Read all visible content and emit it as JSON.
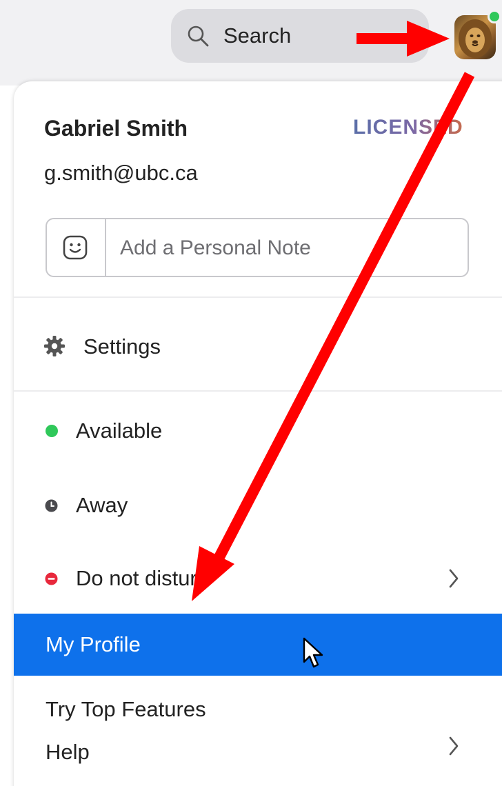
{
  "search": {
    "label": "Search"
  },
  "user": {
    "name": "Gabriel Smith",
    "badge": "LICENSED",
    "email": "g.smith@ubc.ca"
  },
  "note": {
    "placeholder": "Add a Personal Note"
  },
  "menu": {
    "settings": "Settings",
    "available": "Available",
    "away": "Away",
    "dnd": "Do not disturb",
    "my_profile": "My Profile",
    "top_features": "Try Top Features",
    "help": "Help"
  },
  "colors": {
    "accent": "#0e71eb",
    "available": "#2fc85a",
    "away": "#4a4a4e",
    "dnd": "#e8283c",
    "annotation_arrow": "#ff0000"
  },
  "icons": {
    "search": "search-icon",
    "avatar": "avatar",
    "note": "smiley-icon",
    "settings": "gear-icon",
    "away": "clock-icon",
    "dnd": "minus-circle-icon",
    "submenu": "chevron-right-icon",
    "pointer": "mouse-cursor-icon"
  }
}
